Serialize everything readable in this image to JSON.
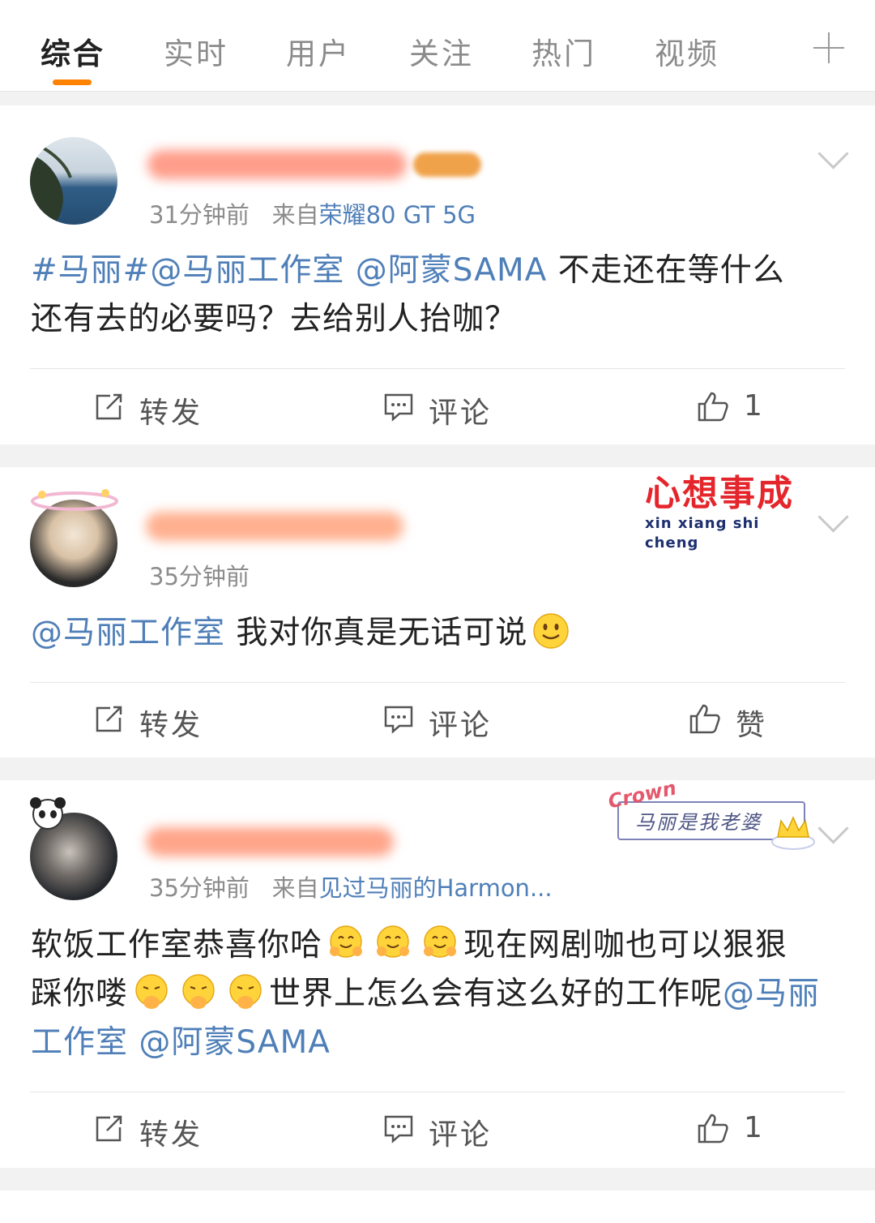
{
  "tabs": {
    "items": [
      "综合",
      "实时",
      "用户",
      "关注",
      "热门",
      "视频"
    ],
    "active_index": 0,
    "add_icon": "plus-icon"
  },
  "colors": {
    "accent": "#ff8200",
    "link": "#4f7fb8",
    "meta": "#8c8c8c"
  },
  "posts": [
    {
      "time": "31分钟前",
      "source_prefix": "来自",
      "source": "荣耀80 GT 5G",
      "content": {
        "hashtag": "#马丽#",
        "mention1": "@马丽工作室",
        "mention2": "@阿蒙SAMA",
        "text1": "不走还在等什么",
        "text2": "还有去的必要吗？去给别人抬咖？"
      },
      "actions": {
        "repost": "转发",
        "comment": "评论",
        "like": "1"
      }
    },
    {
      "time": "35分钟前",
      "badge": {
        "main": "心想事成",
        "pinyin": "xin xiang shi cheng"
      },
      "content": {
        "mention1": "@马丽工作室",
        "text1": "我对你真是无话可说",
        "emoji": "smile-emoji"
      },
      "actions": {
        "repost": "转发",
        "comment": "评论",
        "like": "赞"
      }
    },
    {
      "time": "35分钟前",
      "source_prefix": "来自",
      "source": "见过马丽的Harmon...",
      "badge": {
        "crown": "Crown",
        "text": "马丽是我老婆"
      },
      "content": {
        "text1": "软饭工作室恭喜你哈",
        "text2": "现在网剧咖也可以狠狠",
        "text3": "踩你喽",
        "text4": "世界上怎么会有这么好的工作呢",
        "mention1": "@马丽工作室",
        "mention2": "@阿蒙SAMA",
        "emoji1": "hug-emoji",
        "emoji2": "giggle-emoji"
      },
      "actions": {
        "repost": "转发",
        "comment": "评论",
        "like": "1"
      }
    }
  ]
}
